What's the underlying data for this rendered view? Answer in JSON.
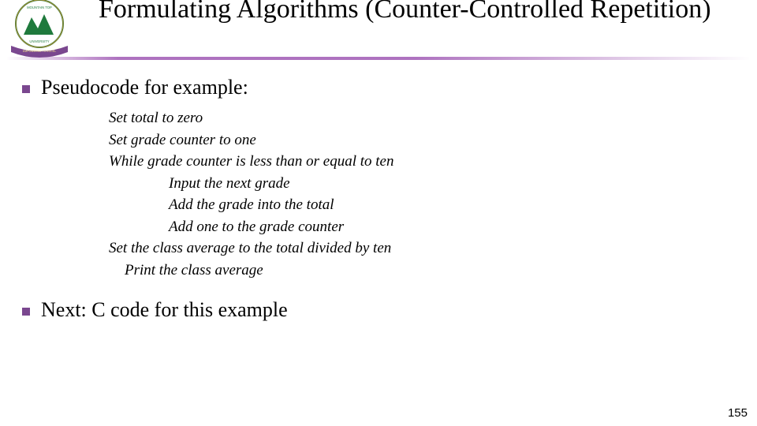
{
  "title": "Formulating Algorithms (Counter-Controlled Repetition)",
  "bullets": {
    "b1": "Pseudocode for example:",
    "b2": "Next: C code for this example"
  },
  "pseudo": {
    "l1": "Set total to zero",
    "l2": "Set grade counter to one",
    "l3": "While grade counter is less than or equal to ten",
    "l4": "Input the next grade",
    "l5": "Add the grade into the total",
    "l6": "Add one to the grade counter",
    "l7": "Set the class average to the total divided by ten",
    "l8": "Print the class average"
  },
  "page_number": "155",
  "logo": {
    "top_text": "MOUNTAIN TOP",
    "bottom_text": "UNIVERSITY",
    "banner": "EMPOWERED TO EXCEL"
  },
  "colors": {
    "accent": "#7a478f",
    "logo_green": "#1f7a3d",
    "logo_gold": "#b48a2e"
  }
}
